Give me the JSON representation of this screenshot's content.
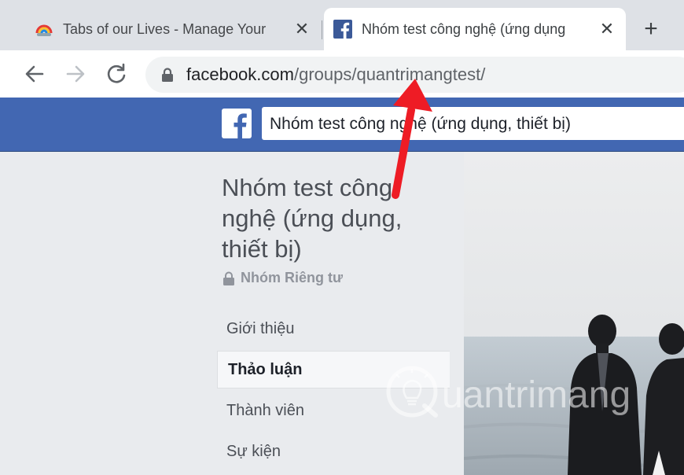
{
  "browser": {
    "tabs": [
      {
        "title": "Tabs of our Lives - Manage Your",
        "close": "✕",
        "favicon": "rainbow-cloud-icon"
      },
      {
        "title": "Nhóm test công nghệ (ứng dụng",
        "close": "✕",
        "favicon": "facebook-icon"
      }
    ],
    "new_tab": "+",
    "address": {
      "domain": "facebook.com",
      "path": "/groups/quantrimangtest/"
    }
  },
  "facebook": {
    "logo_letter": "f",
    "search_value": "Nhóm test công nghệ (ứng dụng, thiết bị)",
    "brand_color": "#4267b2"
  },
  "group": {
    "title": "Nhóm test công nghệ (ứng dụng, thiết bị)",
    "privacy": "Nhóm Riêng tư",
    "nav": [
      {
        "label": "Giới thiệu",
        "active": false
      },
      {
        "label": "Thảo luận",
        "active": true
      },
      {
        "label": "Thành viên",
        "active": false
      },
      {
        "label": "Sự kiện",
        "active": false
      }
    ]
  },
  "watermark": {
    "text": "uantrimang"
  },
  "annotation": {
    "arrow_color": "#ee1c25"
  }
}
